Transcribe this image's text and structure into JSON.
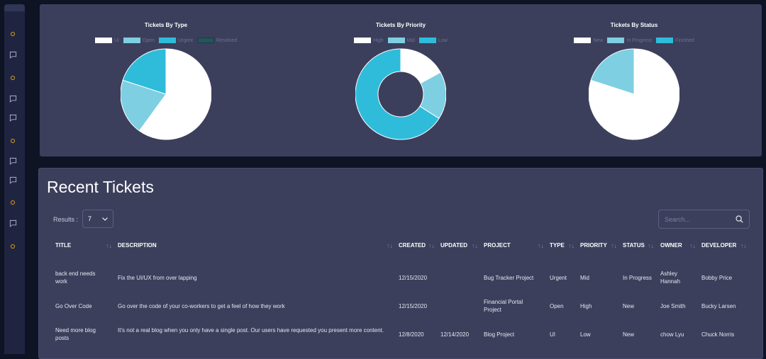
{
  "colors": {
    "white": "#ffffff",
    "light_blue": "#7ecfe2",
    "blue": "#2fbcdb",
    "dark_teal": "#26535d",
    "card": "#3c3f5c"
  },
  "sidebar": {
    "icons": [
      "settings-dot-icon",
      "chat-icon",
      "settings-dot-icon",
      "chat-icon",
      "chat-icon",
      "settings-dot-icon",
      "chat-icon",
      "chat-icon",
      "settings-dot-icon",
      "chat-icon",
      "settings-dot-icon"
    ]
  },
  "charts": {
    "type_chart": {
      "title": "Tickets By Type",
      "legend": [
        "UI",
        "Open",
        "Urgent",
        "Resolved"
      ]
    },
    "priority_chart": {
      "title": "Tickets By Priority",
      "legend": [
        "High",
        "Mid",
        "Low"
      ]
    },
    "status_chart": {
      "title": "Tickets By Status",
      "legend": [
        "New",
        "In Progress",
        "Finished"
      ]
    }
  },
  "chart_data": [
    {
      "type": "pie",
      "title": "Tickets By Type",
      "categories": [
        "UI",
        "Open",
        "Urgent",
        "Resolved"
      ],
      "values": [
        60,
        20,
        20,
        0
      ],
      "colors": [
        "#ffffff",
        "#7ecfe2",
        "#2fbcdb",
        "#26535d"
      ]
    },
    {
      "type": "pie",
      "title": "Tickets By Priority",
      "categories": [
        "High",
        "Mid",
        "Low"
      ],
      "values": [
        17,
        17,
        66
      ],
      "colors": [
        "#ffffff",
        "#7ecfe2",
        "#2fbcdb"
      ]
    },
    {
      "type": "pie",
      "title": "Tickets By Status",
      "categories": [
        "New",
        "In Progress",
        "Finished"
      ],
      "values": [
        80,
        20,
        0
      ],
      "colors": [
        "#ffffff",
        "#7ecfe2",
        "#2fbcdb"
      ]
    }
  ],
  "tickets": {
    "title": "Recent Tickets",
    "results_label": "Results :",
    "results_value": "7",
    "search_placeholder": "Search...",
    "columns": [
      "TITLE",
      "DESCRIPTION",
      "CREATED",
      "UPDATED",
      "PROJECT",
      "TYPE",
      "PRIORITY",
      "STATUS",
      "OWNER",
      "DEVELOPER"
    ],
    "rows": [
      {
        "title": "back end needs work",
        "description": "Fix the UI/UX from over lapping",
        "created": "12/15/2020",
        "updated": "",
        "project": "Bug Tracker Project",
        "type": "Urgent",
        "priority": "Mid",
        "status": "In Progress",
        "owner": "Ashley Hannah",
        "developer": "Bobby Price"
      },
      {
        "title": "Go Over Code",
        "description": "Go over the code of your co-workers to get a feel of how they work",
        "created": "12/15/2020",
        "updated": "",
        "project": "Financial Portal Project",
        "type": "Open",
        "priority": "High",
        "status": "New",
        "owner": "Joe Smith",
        "developer": "Bucky Larsen"
      },
      {
        "title": "Need more blog posts",
        "description": "It's not a real blog when you only have a single post. Our users have requested you present more content.",
        "created": "12/8/2020",
        "updated": "12/14/2020",
        "project": "Blog Project",
        "type": "UI",
        "priority": "Low",
        "status": "New",
        "owner": "chow Lyu",
        "developer": "Chuck Norris"
      }
    ]
  }
}
